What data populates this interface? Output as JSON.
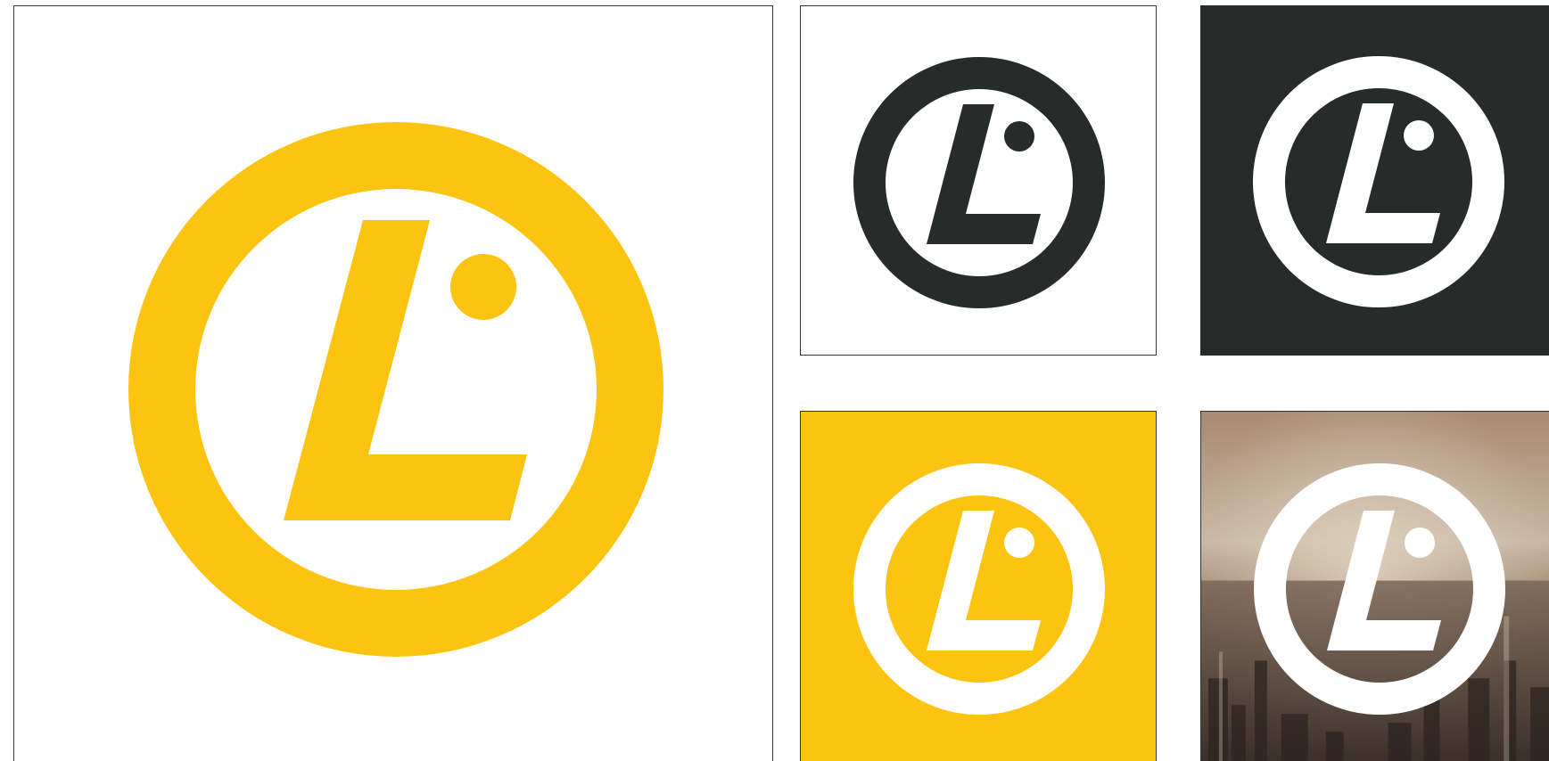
{
  "logo": {
    "name": "L-circle-mark",
    "icon": "l-dot-circle-icon"
  },
  "colors": {
    "brand_yellow": "#FDC311",
    "brand_dark": "#272B29",
    "white": "#FFFFFF",
    "panel_border": "#333333",
    "sky_top": "#b89a80",
    "sky_glow": "#c9b9a4",
    "city_haze": "#7a6454",
    "city_dark": "#3b3029"
  },
  "variants": [
    {
      "id": "primary-yellow-on-white",
      "mark_color": "#FDC311",
      "background": "#FFFFFF"
    },
    {
      "id": "dark-on-white",
      "mark_color": "#272B29",
      "background": "#FFFFFF"
    },
    {
      "id": "white-on-dark",
      "mark_color": "#FFFFFF",
      "background": "#272B29"
    },
    {
      "id": "white-on-yellow",
      "mark_color": "#FFFFFF",
      "background": "#FDC311"
    },
    {
      "id": "white-on-photo",
      "mark_color": "#FFFFFF",
      "background": "city-skyline-photo"
    }
  ]
}
